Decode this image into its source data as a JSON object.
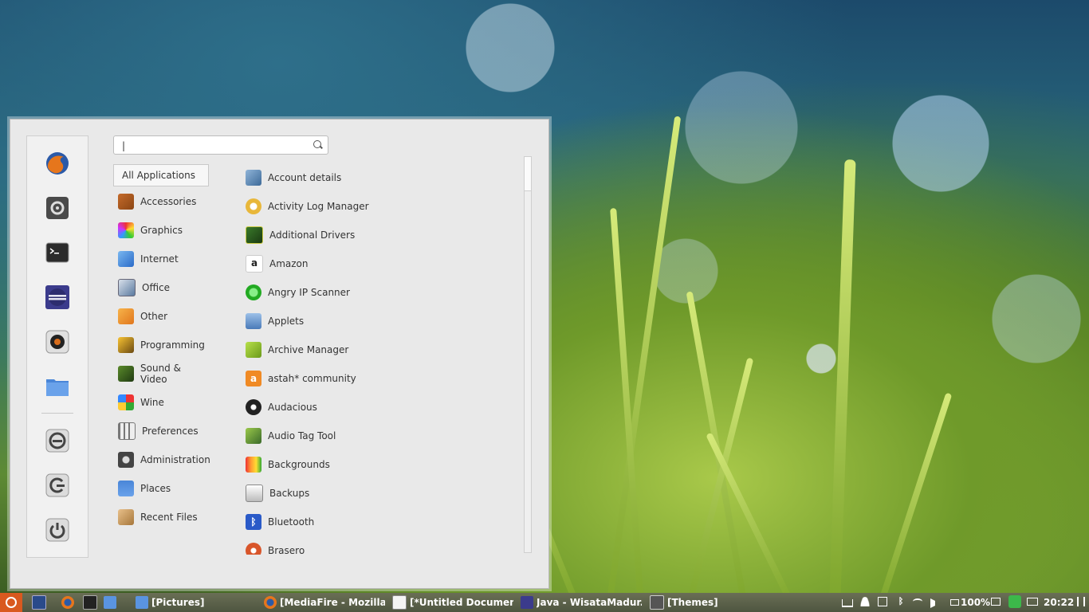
{
  "search": {
    "value": "|"
  },
  "categories": [
    {
      "label": "All Applications"
    },
    {
      "label": "Accessories"
    },
    {
      "label": "Graphics"
    },
    {
      "label": "Internet"
    },
    {
      "label": "Office"
    },
    {
      "label": "Other"
    },
    {
      "label": "Programming"
    },
    {
      "label": "Sound & Video"
    },
    {
      "label": "Wine"
    },
    {
      "label": "Preferences"
    },
    {
      "label": "Administration"
    },
    {
      "label": "Places"
    },
    {
      "label": "Recent Files"
    }
  ],
  "applications": [
    {
      "label": "Account details"
    },
    {
      "label": "Activity Log Manager"
    },
    {
      "label": "Additional Drivers"
    },
    {
      "label": "Amazon"
    },
    {
      "label": "Angry IP Scanner"
    },
    {
      "label": "Applets"
    },
    {
      "label": "Archive Manager"
    },
    {
      "label": "astah* community"
    },
    {
      "label": "Audacious"
    },
    {
      "label": "Audio Tag Tool"
    },
    {
      "label": "Backgrounds"
    },
    {
      "label": "Backups"
    },
    {
      "label": "Bluetooth"
    },
    {
      "label": "Brasero"
    }
  ],
  "favorites": [
    {
      "icon": "firefox-icon"
    },
    {
      "icon": "system-settings-icon"
    },
    {
      "icon": "terminal-icon"
    },
    {
      "icon": "eclipse-icon"
    },
    {
      "icon": "camera-icon"
    },
    {
      "icon": "folder-icon"
    },
    {
      "icon": "lock-screen-icon"
    },
    {
      "icon": "logout-icon"
    },
    {
      "icon": "power-icon"
    }
  ],
  "taskbar": {
    "windows": [
      {
        "label": "[Pictures]"
      },
      {
        "label": "[MediaFire - Mozilla ..."
      },
      {
        "label": "[*Untitled Documen..."
      },
      {
        "label": "Java - WisataMadur..."
      },
      {
        "label": "[Themes]"
      }
    ],
    "battery": "100%",
    "clock": "20:22"
  }
}
